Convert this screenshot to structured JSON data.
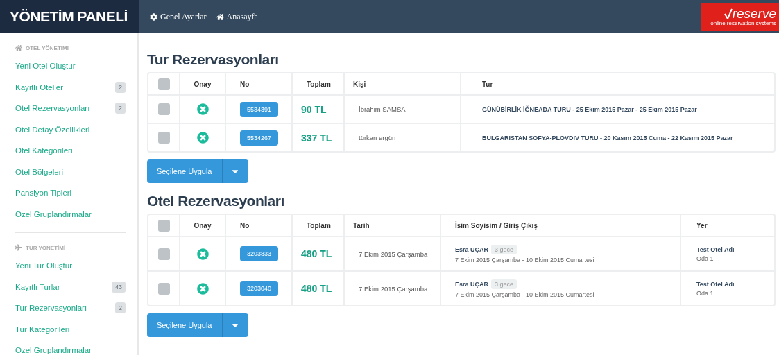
{
  "brand": "YÖNETİM PANELİ",
  "nav": [
    {
      "label": "Genel Ayarlar"
    },
    {
      "label": "Anasayfa"
    }
  ],
  "logo": {
    "name": "reserve",
    "tagline": "online reservation systems"
  },
  "sidebar": [
    {
      "title": "OTEL YÖNETİMİ",
      "items": [
        {
          "label": "Yeni Otel Oluştur"
        },
        {
          "label": "Kayıtlı Oteller",
          "count": "2"
        },
        {
          "label": "Otel Rezervasyonları",
          "count": "2"
        },
        {
          "label": "Otel Detay Özellikleri"
        },
        {
          "label": "Otel Kategorileri"
        },
        {
          "label": "Otel Bölgeleri"
        },
        {
          "label": "Pansiyon Tipleri"
        },
        {
          "label": "Özel Gruplandırmalar"
        }
      ]
    },
    {
      "title": "TUR YÖNETİMİ",
      "items": [
        {
          "label": "Yeni Tur Oluştur"
        },
        {
          "label": "Kayıtlı Turlar",
          "count": "43"
        },
        {
          "label": "Tur Rezervasyonları",
          "count": "2"
        },
        {
          "label": "Tur Kategorileri"
        },
        {
          "label": "Özel Gruplandırmalar"
        }
      ]
    }
  ],
  "tour_reservations": {
    "title": "Tur Rezervasyonları",
    "columns": [
      "Onay",
      "No",
      "Toplam",
      "Kişi",
      "Tur"
    ],
    "select_all": false,
    "rows": [
      {
        "checked": false,
        "approved": false,
        "no": "5534391",
        "total": "90 TL",
        "person": "İbrahim SAMSA",
        "tour": "GÜNÜBİRLİK İĞNEADA TURU - 25 Ekim 2015 Pazar - 25 Ekim 2015 Pazar"
      },
      {
        "checked": false,
        "approved": false,
        "no": "5534267",
        "total": "337 TL",
        "person": "türkan ergün",
        "tour": "BULGARİSTAN SOFYA-PLOVDIV TURU - 20 Kasım 2015 Cuma - 22 Kasım 2015 Pazar"
      }
    ],
    "apply_button": "Seçilene Uygula"
  },
  "hotel_reservations": {
    "title": "Otel Rezervasyonları",
    "columns": [
      "Onay",
      "No",
      "Toplam",
      "Tarih",
      "İsim Soyisim / Giriş Çıkış",
      "Yer"
    ],
    "select_all": false,
    "rows": [
      {
        "checked": false,
        "approved": false,
        "no": "3203833",
        "total": "480 TL",
        "date": "7 Ekim 2015 Çarşamba",
        "name": "Esra UÇAR",
        "nights": "3 gece",
        "stay": "7 Ekim 2015 Çarşamba - 10 Ekim 2015 Cumartesi",
        "hotel": "Test Otel Adı",
        "room": "Oda 1"
      },
      {
        "checked": false,
        "approved": false,
        "no": "3203040",
        "total": "480 TL",
        "date": "7 Ekim 2015 Çarşamba",
        "name": "Esra UÇAR",
        "nights": "3 gece",
        "stay": "7 Ekim 2015 Çarşamba - 10 Ekim 2015 Cumartesi",
        "hotel": "Test Otel Adı",
        "room": "Oda 1"
      }
    ],
    "apply_button": "Seçilene Uygula"
  }
}
